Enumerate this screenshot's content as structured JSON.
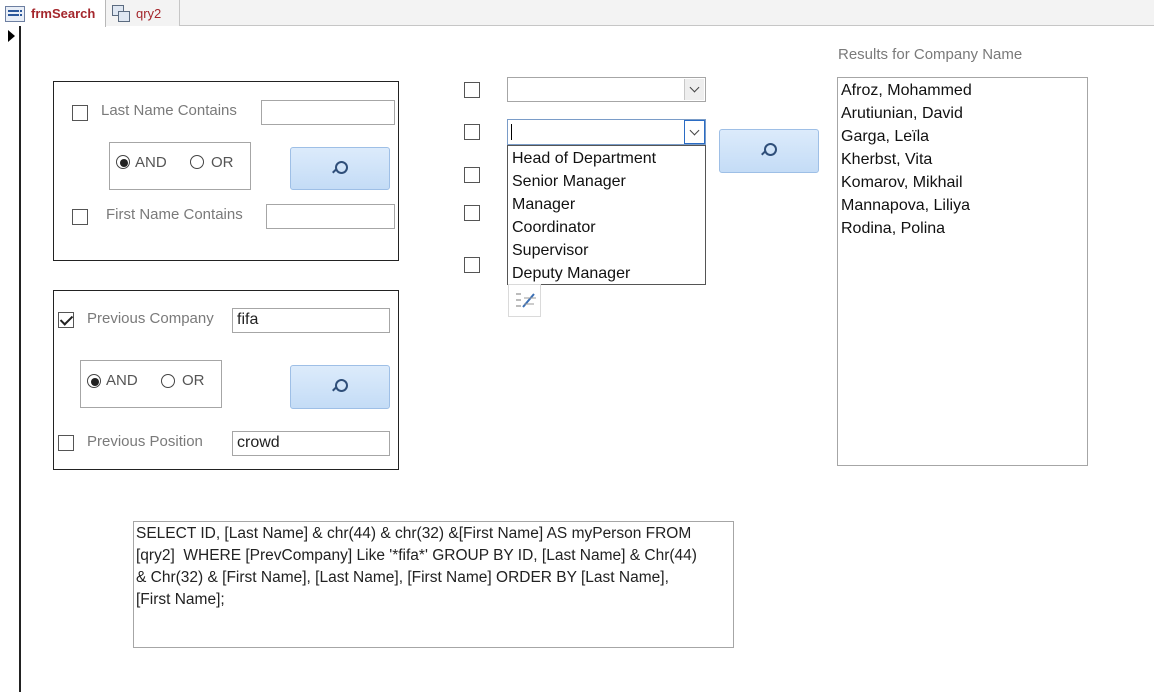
{
  "tabs": [
    {
      "label": "frmSearch",
      "icon": "form-icon",
      "active": true
    },
    {
      "label": "qry2",
      "icon": "query-icon",
      "active": false
    }
  ],
  "group1": {
    "last_name_label": "Last Name Contains",
    "last_name_value": "",
    "and_label": "AND",
    "or_label": "OR",
    "selected_operator": "AND",
    "first_name_label": "First Name Contains",
    "first_name_value": ""
  },
  "group2": {
    "prev_company_label": "Previous Company",
    "prev_company_value": "fifa",
    "prev_company_checked": true,
    "and_label": "AND",
    "or_label": "OR",
    "selected_operator": "AND",
    "prev_position_label": "Previous Position",
    "prev_position_value": "crowd"
  },
  "combos": {
    "combo1_value": "",
    "combo2_value": "",
    "dropdown_options": [
      "Head of Department",
      "Senior Manager",
      "Manager",
      "Coordinator",
      "Supervisor",
      "Deputy Manager"
    ]
  },
  "sql_text": "SELECT ID, [Last Name] & chr(44) & chr(32) &[First Name] AS myPerson FROM\n[qry2]  WHERE [PrevCompany] Like '*fifa*' GROUP BY ID, [Last Name] & Chr(44)\n& Chr(32) & [First Name], [Last Name], [First Name] ORDER BY [Last Name],\n[First Name];",
  "results": {
    "title": "Results for Company Name",
    "items": [
      "Afroz, Mohammed",
      "Arutiunian, David",
      "Garga, Leïla",
      "Kherbst, Vita",
      "Komarov, Mikhail",
      "Mannapova, Liliya",
      "Rodina, Polina"
    ]
  }
}
